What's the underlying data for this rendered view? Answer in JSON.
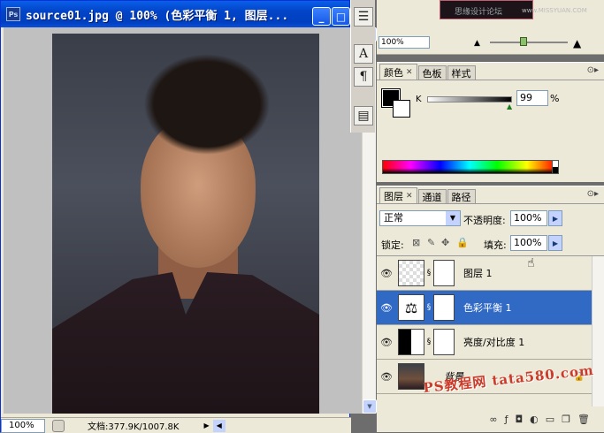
{
  "document": {
    "title": "source01.jpg @ 100% (色彩平衡 1, 图层...",
    "app_icon": "Ps",
    "zoom": "100%",
    "doc_info": "文档:377.9K/1007.8K"
  },
  "toolstrip": {
    "tools": [
      "layer-comps-icon",
      "character-icon",
      "paragraph-icon",
      "history-icon"
    ]
  },
  "navigator": {
    "zoom": "100%",
    "thumbnail_text": "思缘设计论坛",
    "thumbnail_url": "www.MISSYUAN.COM"
  },
  "color_panel": {
    "tabs": [
      "颜色",
      "色板",
      "样式"
    ],
    "channel_label": "K",
    "channel_value": "99",
    "unit": "%",
    "foreground": "#000000",
    "background": "#ffffff"
  },
  "layers_panel": {
    "tabs": [
      "图层",
      "通道",
      "路径"
    ],
    "blend_mode": "正常",
    "opacity_label": "不透明度:",
    "opacity": "100%",
    "lock_label": "锁定:",
    "fill_label": "填充:",
    "fill": "100%",
    "layers": [
      {
        "name": "图层 1",
        "selected": false
      },
      {
        "name": "色彩平衡 1",
        "selected": true
      },
      {
        "name": "亮度/对比度 1",
        "selected": false
      },
      {
        "name": "背景",
        "selected": false
      }
    ]
  },
  "watermark": "PS教程网 tata580.com",
  "colors": {
    "selection": "#316ac5",
    "titlebar": "#0a5fe8"
  }
}
